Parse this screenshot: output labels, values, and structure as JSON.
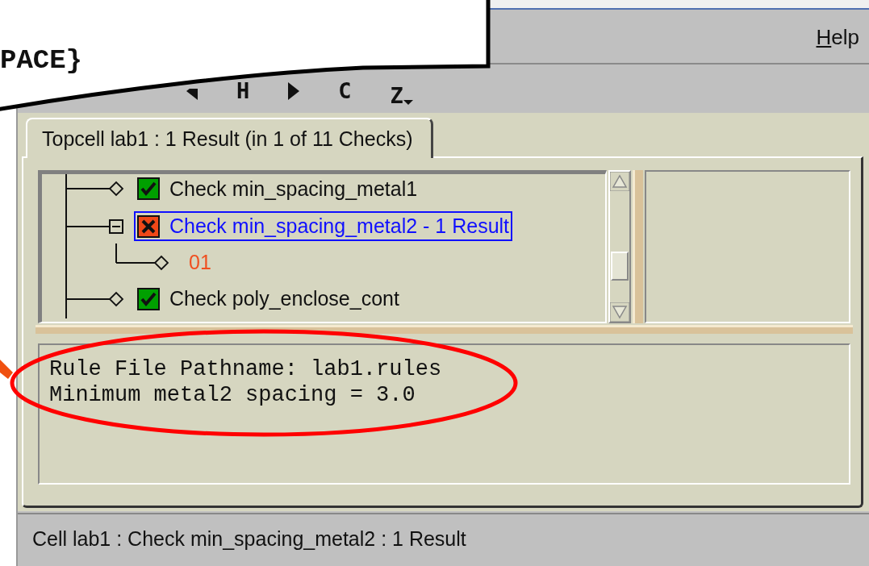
{
  "callout": {
    "text": "PACE}"
  },
  "menu_bar": {
    "items": [
      {
        "label": "Help"
      }
    ]
  },
  "toolbar": [
    {
      "kind": "back"
    },
    {
      "kind": "text",
      "label": "H"
    },
    {
      "kind": "forward"
    },
    {
      "kind": "text",
      "label": "C"
    },
    {
      "kind": "menu",
      "label": "Z"
    }
  ],
  "tab": {
    "label": "Topcell lab1 : 1 Result (in 1 of 11 Checks)",
    "selected": true
  },
  "tree": {
    "items": [
      {
        "label": "Check min_spacing_metal1",
        "kind": "pass",
        "selected": false
      },
      {
        "label": "Check min_spacing_metal2 - 1 Result",
        "kind": "fail",
        "selected": true,
        "expanded": true,
        "children": [
          {
            "label": "01",
            "kind": "result"
          }
        ]
      },
      {
        "label": "Check poly_enclose_cont",
        "kind": "pass",
        "selected": false
      }
    ]
  },
  "details": {
    "lines": [
      "Rule File Pathname: lab1.rules",
      "Minimum metal2 spacing = 3.0"
    ]
  },
  "status_bar": {
    "text": "Cell lab1 : Check min_spacing_metal2 : 1 Result"
  }
}
